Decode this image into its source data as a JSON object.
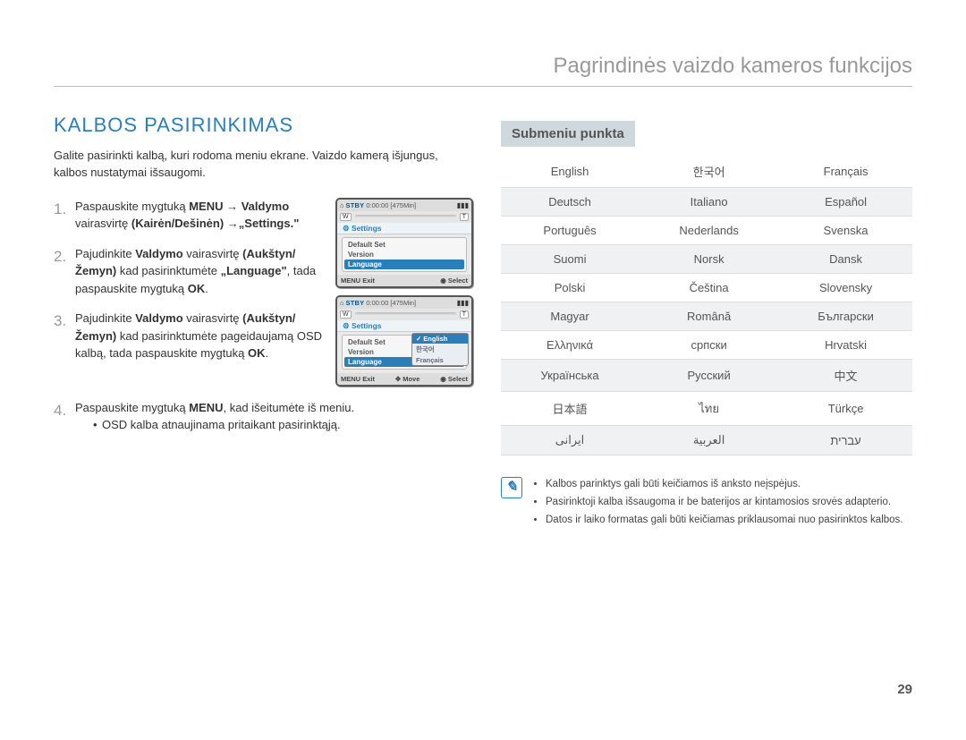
{
  "header": {
    "breadcrumb": "Pagrindinės vaizdo kameros funkcijos"
  },
  "section": {
    "title": "KALBOS PASIRINKIMAS",
    "intro": "Galite pasirinkti kalbą, kuri rodoma meniu ekrane. Vaizdo kamerą išjungus, kalbos nustatymai išsaugomi."
  },
  "steps": {
    "s1": {
      "num": "1.",
      "t1": "Paspauskite mygtuką ",
      "b1": "MENU",
      "arrow1": " → ",
      "b2": "Valdymo",
      "t2": " vairasvirtę ",
      "b3": "(Kairėn/Dešinėn)",
      "arrow2": " →",
      "b4": "„Settings.\""
    },
    "s2": {
      "num": "2.",
      "t1": "Pajudinkite ",
      "b1": "Valdymo",
      "t2": " vairasvirtę ",
      "b2": "(Aukštyn/Žemyn)",
      "t3": " kad pasirinktumėte ",
      "b3": "„Language\"",
      "t4": ", tada paspauskite mygtuką ",
      "b4": "OK",
      "t5": "."
    },
    "s3": {
      "num": "3.",
      "t1": "Pajudinkite ",
      "b1": "Valdymo",
      "t2": " vairasvirtę ",
      "b2": "(Aukštyn/Žemyn)",
      "t3": " kad pasirinktumėte pageidaujamą OSD kalbą, tada paspauskite mygtuką ",
      "b3": "OK",
      "t4": "."
    },
    "s4": {
      "num": "4.",
      "t1": "Paspauskite mygtuką ",
      "b1": "MENU",
      "t2": ", kad išeitumėte iš meniu.",
      "bullet": "OSD kalba atnaujinama pritaikant pasirinktąją."
    }
  },
  "screen": {
    "stby": "STBY",
    "time": "0:00:00",
    "remain": "[475Min]",
    "zoom_w": "W",
    "zoom_t": "T",
    "settings": "Settings",
    "r_default": "Default Set",
    "r_version": "Version",
    "r_language": "Language",
    "menu": "MENU",
    "exit": "Exit",
    "move": "Move",
    "select": "Select",
    "pop_english": "English",
    "pop_korean": "한국어",
    "pop_francais": "Français"
  },
  "submenu": {
    "title": "Submeniu punkta",
    "rows": [
      [
        "English",
        "한국어",
        "Français"
      ],
      [
        "Deutsch",
        "Italiano",
        "Español"
      ],
      [
        "Português",
        "Nederlands",
        "Svenska"
      ],
      [
        "Suomi",
        "Norsk",
        "Dansk"
      ],
      [
        "Polski",
        "Čeština",
        "Slovensky"
      ],
      [
        "Magyar",
        "Română",
        "Български"
      ],
      [
        "Ελληνικά",
        "српски",
        "Hrvatski"
      ],
      [
        "Українська",
        "Русский",
        "中文"
      ],
      [
        "日本語",
        "ไทย",
        "Türkçe"
      ],
      [
        "ایرانی",
        "العربية",
        "עברית"
      ]
    ]
  },
  "note": {
    "b1": "Kalbos parinktys gali būti keičiamos iš anksto neįspėjus.",
    "b2": "Pasirinktoji kalba išsaugoma ir be baterijos ar kintamosios srovės adapterio.",
    "b3": "Datos ir laiko formatas gali būti keičiamas priklausomai nuo pasirinktos kalbos."
  },
  "page_number": "29"
}
